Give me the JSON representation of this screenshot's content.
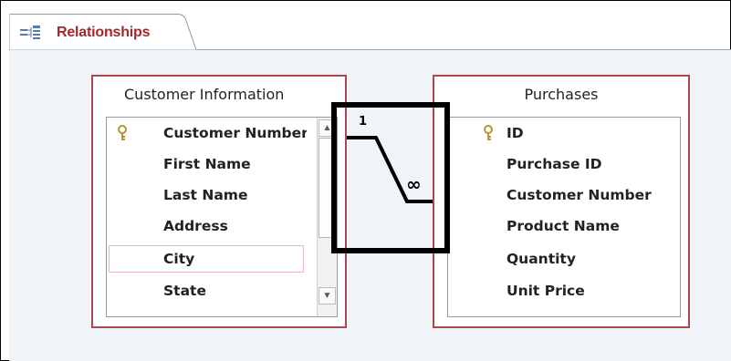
{
  "tab": {
    "label": "Relationships",
    "icon": "relationships-icon"
  },
  "colors": {
    "accent": "#a4262c",
    "table_border": "#b0464f",
    "background": "#f0f3f7"
  },
  "tables": [
    {
      "title": "Customer Information",
      "fields": [
        {
          "label": "Customer Number",
          "is_key": true
        },
        {
          "label": "First Name",
          "is_key": false
        },
        {
          "label": "Last Name",
          "is_key": false
        },
        {
          "label": "Address",
          "is_key": false
        },
        {
          "label": "City",
          "is_key": false
        },
        {
          "label": "State",
          "is_key": false
        }
      ],
      "selected_field": "City"
    },
    {
      "title": "Purchases",
      "fields": [
        {
          "label": "ID",
          "is_key": true
        },
        {
          "label": "Purchase ID",
          "is_key": false
        },
        {
          "label": "Customer Number",
          "is_key": false
        },
        {
          "label": "Product Name",
          "is_key": false
        },
        {
          "label": "Quantity",
          "is_key": false
        },
        {
          "label": "Unit Price",
          "is_key": false
        }
      ]
    }
  ],
  "relationship": {
    "one_side": "1",
    "many_side": "∞"
  }
}
